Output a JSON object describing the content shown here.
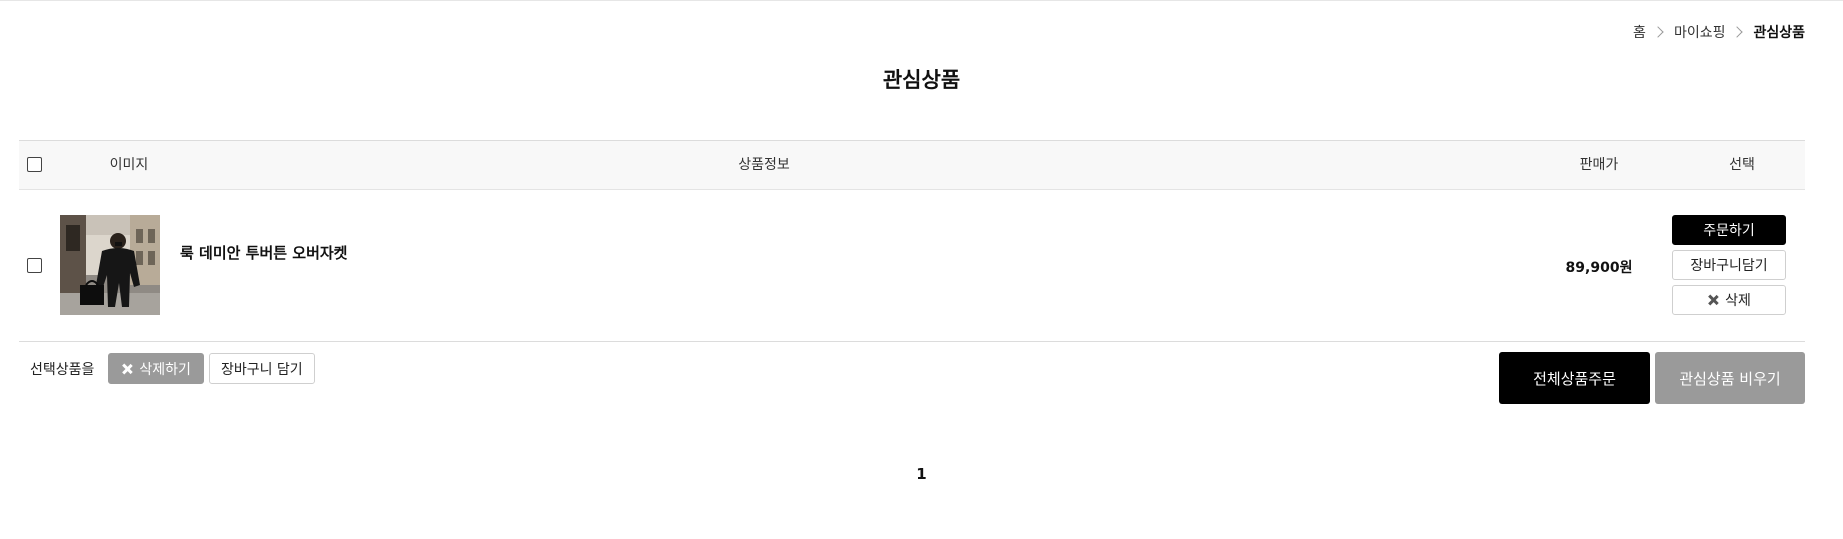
{
  "breadcrumb": [
    {
      "label": "홈"
    },
    {
      "label": "마이쇼핑"
    },
    {
      "label": "관심상품"
    }
  ],
  "page_title": "관심상품",
  "table": {
    "headers": {
      "image": "이미지",
      "info": "상품정보",
      "price": "판매가",
      "select": "선택"
    },
    "rows": [
      {
        "product_name": "룩 데미안 투버튼 오버자켓",
        "price": "89,900원",
        "order_label": "주문하기",
        "cart_label": "장바구니담기",
        "delete_label": "삭제"
      }
    ]
  },
  "selection_bar": {
    "label": "선택상품을",
    "delete_label": "삭제하기",
    "cart_label": "장바구니 담기"
  },
  "actions": {
    "order_all": "전체상품주문",
    "clear_wishlist": "관심상품 비우기"
  },
  "pagination": {
    "current": "1"
  },
  "colors": {
    "primary": "#000000",
    "muted_button": "#9a9a9a",
    "header_bg": "#f8f8f8"
  }
}
